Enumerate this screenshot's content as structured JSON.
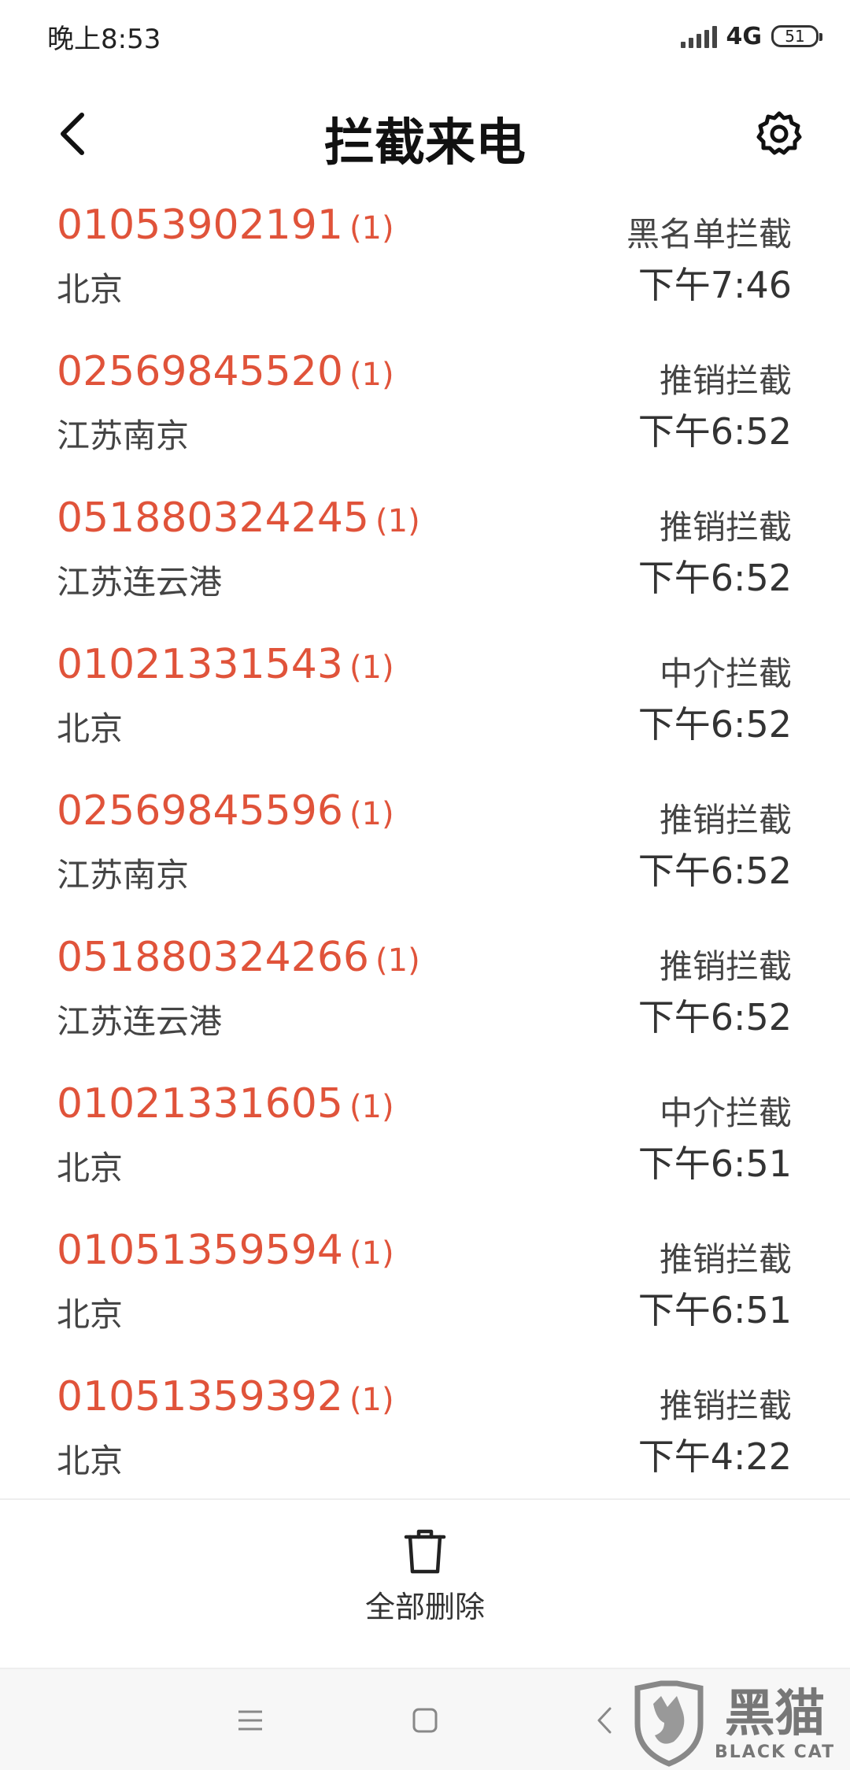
{
  "status_bar": {
    "time": "晚上8:53",
    "network": "4G",
    "battery": "51"
  },
  "header": {
    "title": "拦截来电"
  },
  "calls": [
    {
      "number": "01053902191",
      "count": "(1)",
      "location": "北京",
      "type": "黑名单拦截",
      "time": "下午7:46"
    },
    {
      "number": "02569845520",
      "count": "(1)",
      "location": "江苏南京",
      "type": "推销拦截",
      "time": "下午6:52"
    },
    {
      "number": "051880324245",
      "count": "(1)",
      "location": "江苏连云港",
      "type": "推销拦截",
      "time": "下午6:52"
    },
    {
      "number": "01021331543",
      "count": "(1)",
      "location": "北京",
      "type": "中介拦截",
      "time": "下午6:52"
    },
    {
      "number": "02569845596",
      "count": "(1)",
      "location": "江苏南京",
      "type": "推销拦截",
      "time": "下午6:52"
    },
    {
      "number": "051880324266",
      "count": "(1)",
      "location": "江苏连云港",
      "type": "推销拦截",
      "time": "下午6:52"
    },
    {
      "number": "01021331605",
      "count": "(1)",
      "location": "北京",
      "type": "中介拦截",
      "time": "下午6:51"
    },
    {
      "number": "01051359594",
      "count": "(1)",
      "location": "北京",
      "type": "推销拦截",
      "time": "下午6:51"
    },
    {
      "number": "01051359392",
      "count": "(1)",
      "location": "北京",
      "type": "推销拦截",
      "time": "下午4:22"
    }
  ],
  "actions": {
    "delete_all": "全部删除"
  },
  "watermark": {
    "cn": "黑猫",
    "en": "BLACK CAT"
  },
  "colors": {
    "number": "#e0533a",
    "text": "#444444"
  },
  "icons": [
    "back-arrow-icon",
    "gear-icon",
    "trash-icon",
    "menu-icon",
    "home-icon",
    "nav-back-icon"
  ]
}
